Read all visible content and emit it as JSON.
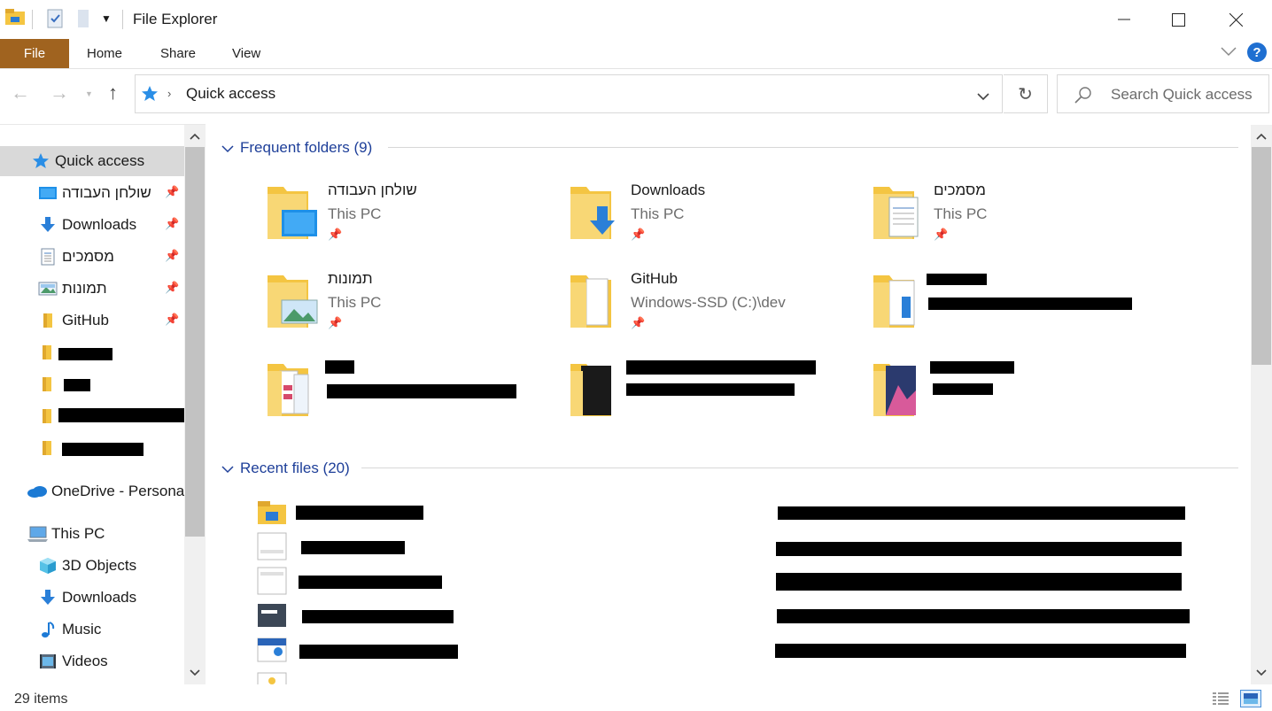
{
  "window": {
    "title": "File Explorer"
  },
  "ribbon": {
    "tabs": [
      "File",
      "Home",
      "Share",
      "View"
    ]
  },
  "address": {
    "location": "Quick access",
    "search_placeholder": "Search Quick access"
  },
  "nav": {
    "quick_access": "Quick access",
    "pinned": [
      {
        "label": "שולחן העבודה",
        "icon": "desktop-icon"
      },
      {
        "label": "Downloads",
        "icon": "download-icon"
      },
      {
        "label": "מסמכים",
        "icon": "documents-icon"
      },
      {
        "label": "תמונות",
        "icon": "pictures-icon"
      },
      {
        "label": "GitHub",
        "icon": "folder-icon"
      }
    ],
    "onedrive": "OneDrive - Persona",
    "this_pc": "This PC",
    "pc_items": [
      {
        "label": "3D Objects",
        "icon": "3d-objects-icon"
      },
      {
        "label": "Downloads",
        "icon": "download-icon"
      },
      {
        "label": "Music",
        "icon": "music-icon"
      },
      {
        "label": "Videos",
        "icon": "videos-icon"
      }
    ]
  },
  "frequent": {
    "header": "Frequent folders (9)",
    "items": [
      {
        "name": "שולחן העבודה",
        "location": "This PC"
      },
      {
        "name": "Downloads",
        "location": "This PC"
      },
      {
        "name": "מסמכים",
        "location": "This PC"
      },
      {
        "name": "תמונות",
        "location": "This PC"
      },
      {
        "name": "GitHub",
        "location": "Windows-SSD (C:)\\dev"
      }
    ]
  },
  "recent": {
    "header": "Recent files (20)"
  },
  "status": {
    "items": "29 items"
  },
  "colors": {
    "file_tab": "#a0631f",
    "section_header": "#1e3f99",
    "selected": "#cce8ff"
  }
}
